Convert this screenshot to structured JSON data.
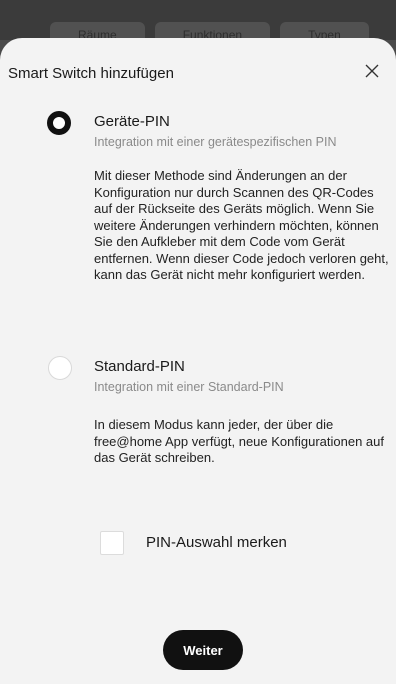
{
  "background": {
    "tabs": [
      "Räume",
      "Funktionen",
      "Typen"
    ]
  },
  "dialog": {
    "title": "Smart Switch hinzufügen",
    "close_icon": "close-icon",
    "options": [
      {
        "title": "Geräte-PIN",
        "subtitle": "Integration mit einer gerätespezifischen PIN",
        "description": "Mit dieser Methode sind Änderungen an der Konfiguration nur durch Scannen des QR-Codes auf der Rückseite des Geräts möglich. Wenn Sie weitere Änderungen verhindern möchten, können Sie den Aufkleber mit dem Code vom Gerät entfernen. Wenn dieser Code jedoch verloren geht, kann das Gerät nicht mehr konfiguriert werden.",
        "selected": true
      },
      {
        "title": "Standard-PIN",
        "subtitle": "Integration mit einer Standard-PIN",
        "description": "In diesem Modus kann jeder, der über die free@home App verfügt, neue Konfigurationen auf das Gerät schreiben.",
        "selected": false
      }
    ],
    "remember_label": "PIN-Auswahl merken",
    "remember_checked": false,
    "continue_label": "Weiter"
  },
  "colors": {
    "sheet": "#f3f3f3",
    "primary": "#111111",
    "muted_text": "#8a8a8a"
  }
}
